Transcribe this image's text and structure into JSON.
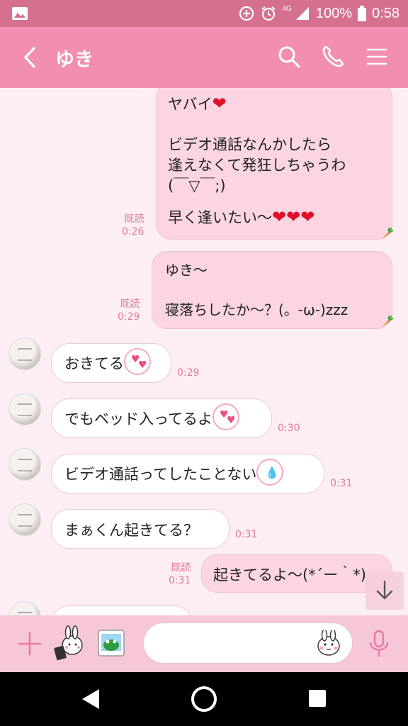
{
  "status": {
    "network": "4G",
    "battery": "100%",
    "time": "0:58"
  },
  "header": {
    "title": "ゆき"
  },
  "read_label": "既読",
  "messages": {
    "m1": {
      "line1": "ヤバイ",
      "line2": "ビデオ通話なんかしたら\n逢えなくて発狂しちゃうわ\n(￣▽￣;)",
      "line3": "早く逢いたい〜",
      "time": "0:26"
    },
    "m2": {
      "text": "ゆき〜\n\n寝落ちしたか〜？(。-ω-)zzz",
      "time": "0:29"
    },
    "m3": {
      "text": "おきてる",
      "time": "0:29"
    },
    "m4": {
      "text": "でもベッド入ってるよ",
      "time": "0:30"
    },
    "m5": {
      "text": "ビデオ通話ってしたことない",
      "time": "0:31"
    },
    "m6": {
      "text": "まぁくん起きてる？",
      "time": "0:31"
    },
    "m7": {
      "text": "起きてるよ〜(*´ー｀*)",
      "time": "0:31"
    }
  },
  "icons": [
    "image-icon",
    "add-circle-icon",
    "alarm-icon",
    "signal-icon",
    "battery-icon",
    "back-icon",
    "search-icon",
    "phone-icon",
    "menu-icon",
    "plus-icon",
    "sticker-icon",
    "photo-icon",
    "emoji-icon",
    "mic-icon",
    "scroll-down-icon"
  ],
  "colors": {
    "header": "#f28fb0",
    "statusbar": "#d6708f",
    "my_bubble": "#fbd5e2",
    "accent": "#e07aa0"
  }
}
